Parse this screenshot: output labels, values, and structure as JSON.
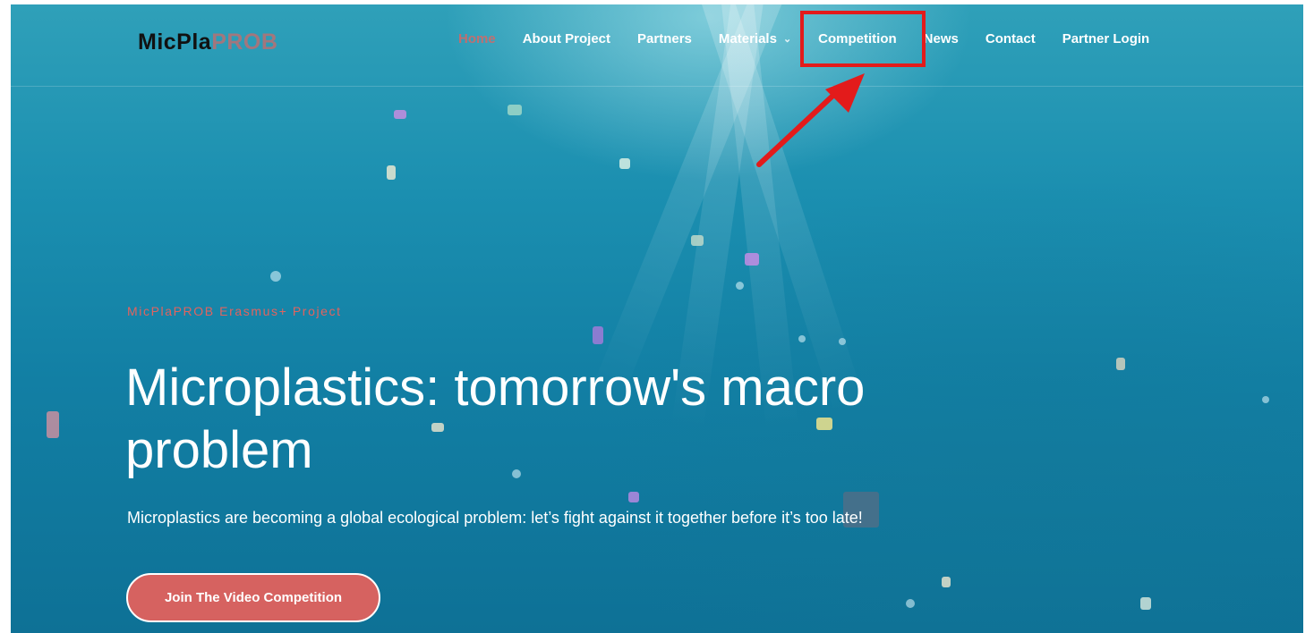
{
  "brand": {
    "logo_dark": "MicPla",
    "logo_light": "PROB"
  },
  "nav": {
    "items": [
      {
        "label": "Home",
        "active": true
      },
      {
        "label": "About Project"
      },
      {
        "label": "Partners"
      },
      {
        "label": "Materials",
        "has_dropdown": true
      },
      {
        "label": "Competition",
        "highlighted": true
      },
      {
        "label": "News"
      },
      {
        "label": "Contact"
      },
      {
        "label": "Partner Login"
      }
    ]
  },
  "hero": {
    "eyebrow": "MicPlaPROB Erasmus+ Project",
    "title": "Microplastics: tomorrow's macro problem",
    "subtitle": "Microplastics are becoming a global ecological problem: let’s fight against it together before it’s too late!",
    "cta_label": "Join The Video Competition"
  },
  "colors": {
    "accent": "#e2635f",
    "cta_bg": "#d66260",
    "highlight_red": "#e31b1b",
    "water_top": "#2fa0b9",
    "water_bottom": "#0e7196"
  },
  "icons": {
    "dropdown": "chevron-down-icon",
    "annotation": "red-arrow-icon"
  }
}
